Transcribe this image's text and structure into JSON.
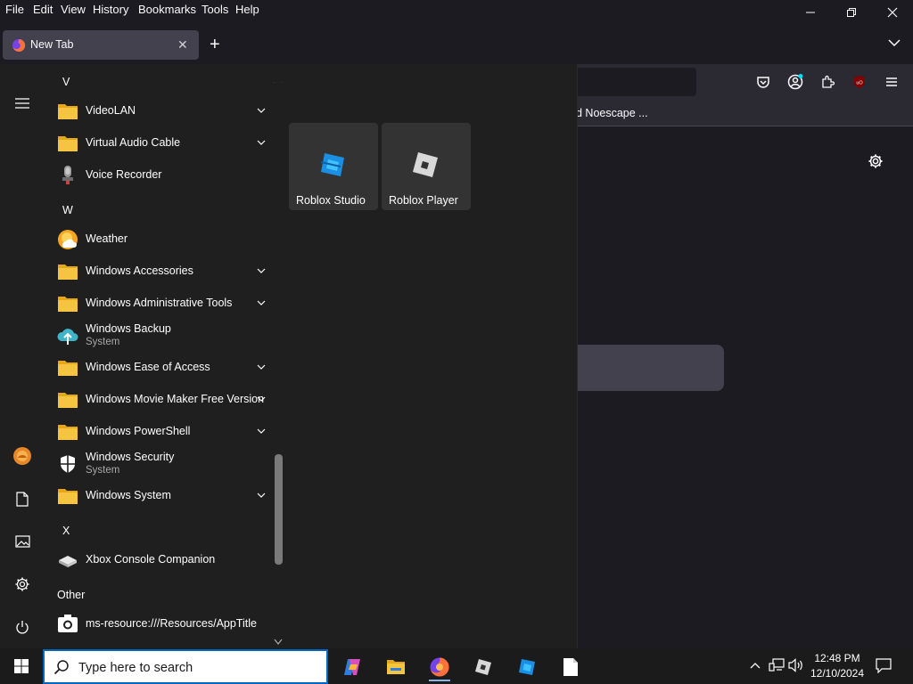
{
  "menubar": {
    "items": [
      "File",
      "Edit",
      "View",
      "History",
      "Bookmarks",
      "Tools",
      "Help"
    ],
    "hotkeys": [
      "F",
      "E",
      "V",
      "s",
      "B",
      "T",
      "H"
    ]
  },
  "tab": {
    "title": "New Tab"
  },
  "bookmarks": {
    "visible_item": "d Noescape ..."
  },
  "start_menu": {
    "top_letter": "V",
    "apps": [
      {
        "name": "VideoLAN",
        "icon": "folder-icon",
        "expandable": true
      },
      {
        "name": "Virtual Audio Cable",
        "icon": "folder-icon",
        "expandable": true
      },
      {
        "name": "Voice Recorder",
        "icon": "microphone-icon",
        "expandable": false
      }
    ],
    "letter_w": "W",
    "apps_w": [
      {
        "name": "Weather",
        "icon": "weather-icon",
        "expandable": false
      },
      {
        "name": "Windows Accessories",
        "icon": "folder-icon",
        "expandable": true
      },
      {
        "name": "Windows Administrative Tools",
        "icon": "folder-icon",
        "expandable": true
      },
      {
        "name": "Windows Backup",
        "sub": "System",
        "icon": "cloud-upload-icon",
        "expandable": false
      },
      {
        "name": "Windows Ease of Access",
        "icon": "folder-icon",
        "expandable": true
      },
      {
        "name": "Windows Movie Maker Free Version",
        "icon": "folder-icon",
        "expandable": true
      },
      {
        "name": "Windows PowerShell",
        "icon": "folder-icon",
        "expandable": true
      },
      {
        "name": "Windows Security",
        "sub": "System",
        "icon": "shield-icon",
        "expandable": false
      },
      {
        "name": "Windows System",
        "icon": "folder-icon",
        "expandable": true
      }
    ],
    "letter_x": "X",
    "apps_x": [
      {
        "name": "Xbox Console Companion",
        "icon": "xbox-console-icon",
        "expandable": false
      }
    ],
    "letter_other": "Other",
    "apps_other": [
      {
        "name": "ms-resource:///Resources/AppTitle",
        "icon": "camera-icon",
        "expandable": false
      }
    ],
    "tiles": [
      {
        "label": "Roblox Studio",
        "icon": "roblox-studio-icon"
      },
      {
        "label": "Roblox Player",
        "icon": "roblox-player-icon"
      }
    ]
  },
  "taskbar": {
    "search_placeholder": "Type here to search",
    "apps": [
      "copilot-icon",
      "file-explorer-icon",
      "firefox-icon",
      "roblox-player-icon",
      "roblox-studio-icon",
      "notepad-icon"
    ],
    "time": "12:48 PM",
    "date": "12/10/2024"
  },
  "colors": {
    "accent": "#0067c0",
    "folder": "#f5c542",
    "taskbar": "#1b1b1b",
    "start_bg": "#1f1f1f"
  }
}
